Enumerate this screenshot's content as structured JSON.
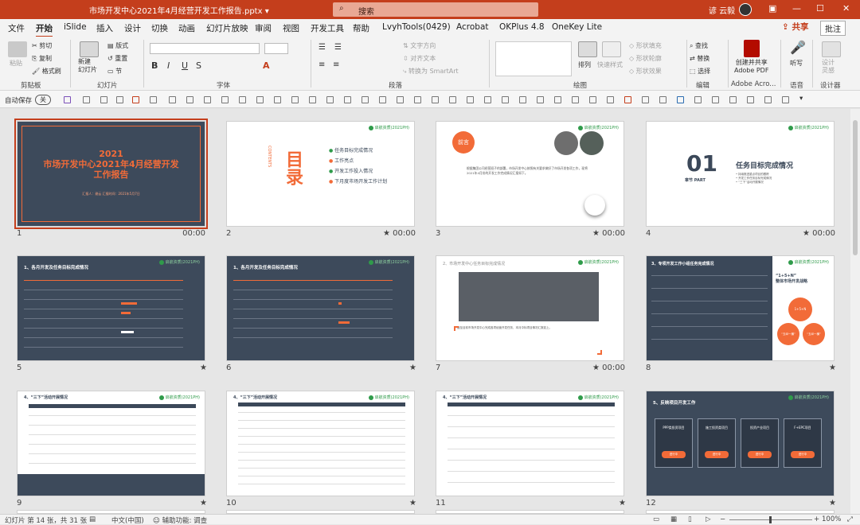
{
  "titlebar": {
    "title": "市场开发中心2021年4月经营开发工作报告.pptx  ▾",
    "search": "搜索",
    "user": "谚 云毅",
    "icons": [
      "minimize-icon",
      "maximize-icon",
      "close-icon"
    ]
  },
  "menu": {
    "items": [
      "文件",
      "开始",
      "iSlide",
      "插入",
      "设计",
      "切换",
      "动画",
      "幻灯片放映",
      "审阅",
      "视图",
      "开发工具",
      "帮助",
      "LvyhTools(0429)",
      "Acrobat",
      "OKPlus 4.8",
      "OneKey Lite"
    ],
    "active": "开始",
    "share": "共享",
    "comment": "批注"
  },
  "ribbon": {
    "clipboard": {
      "paste": "粘贴",
      "cut": "剪切",
      "copy": "复制",
      "format": "格式刷",
      "group": "剪贴板"
    },
    "slides": {
      "new": "新建\n幻灯片",
      "layout": "版式",
      "reset": "重置",
      "section": "节",
      "group": "幻灯片"
    },
    "font": {
      "group": "字体",
      "font_name": "",
      "font_size": ""
    },
    "paragraph": {
      "group": "段落",
      "direction": "文字方向",
      "align": "对齐文本",
      "smartart": "转换为 SmartArt"
    },
    "drawing": {
      "group": "绘图",
      "arrange": "排列",
      "quick": "快速样式",
      "fill": "形状填充",
      "outline": "形状轮廓",
      "effect": "形状效果"
    },
    "editing": {
      "group": "编辑",
      "find": "查找",
      "replace": "替换",
      "select": "选择"
    },
    "adobe": {
      "group": "Adobe Acro...",
      "create": "创建并共享\nAdobe PDF"
    },
    "voice": {
      "group": "语音",
      "dictate": "听写"
    },
    "designer": {
      "group": "设计器",
      "ideas": "设计\n灵感"
    }
  },
  "qat": {
    "autosave": "自动保存",
    "toggle": "关"
  },
  "slides": [
    {
      "n": "1",
      "time": "00:00",
      "title": "2021\n市场开发中心2021年4月经营开发\n工作报告",
      "sub": "汇报人：谢云   汇报时间：2021年5月7日"
    },
    {
      "n": "2",
      "time": "00:00",
      "star": "★",
      "big": "目录",
      "contents": "CONTENTS",
      "items": [
        "任务目标完成情况",
        "工作亮点",
        "开发工作投入情况",
        "下月度市场开发工作计划"
      ]
    },
    {
      "n": "3",
      "time": "00:00",
      "star": "★",
      "tag": "前言",
      "body": "根据集团公司经营班子的部署，市场开发中心按照有关要求做好了市场开发各项工作，现将2021年4月份的开发工作完成情况汇报如下。"
    },
    {
      "n": "4",
      "time": "00:00",
      "star": "★",
      "big": "01",
      "chapter": "章节 PART",
      "heading": "任务目标完成情况",
      "points": [
        "• 持续推进重点项目的跟踪",
        "• 开发工作任务目标完成情况",
        "• “三下”活动开展情况"
      ]
    },
    {
      "n": "5",
      "star": "★",
      "heading": "1、各月开发及任务目标完成情况"
    },
    {
      "n": "6",
      "star": "★",
      "heading": "1、各月开发及任务目标完成情况"
    },
    {
      "n": "7",
      "time": "00:00",
      "star": "★",
      "heading": "2、市场开发中心任务目标完成情况",
      "body": "截至目前市场开发中心完成各项经营开发任务，本月中标项目情况汇报如上。"
    },
    {
      "n": "8",
      "star": "★",
      "heading": "3、专项开发工作小组任务完成情况",
      "quote": "“1+5+N”\n整体市场开发战略",
      "circles": [
        "1+5+N",
        "“五纵一横”",
        "“五纵一横”"
      ]
    },
    {
      "n": "9",
      "star": "★",
      "heading": "4、“三下”活动开展情况"
    },
    {
      "n": "10",
      "star": "★",
      "heading": "4、“三下”活动开展情况"
    },
    {
      "n": "11",
      "star": "★",
      "heading": "4、“三下”活动开展情况"
    },
    {
      "n": "12",
      "star": "★",
      "heading": "5、反映项目开发工作",
      "cards": [
        "PPP类投资项目",
        "施工投资类项目",
        "投资产业项目",
        "F+EPC项目"
      ],
      "btn": "进行中"
    }
  ],
  "logo": "启航资质(2021PH)",
  "status": {
    "slide": "幻灯片 第 14 张，共 31 张",
    "lang": "中文(中国)",
    "access": "辅助功能: 调查",
    "zoom": "100%"
  },
  "colors": {
    "accent": "#c43e1c",
    "orange": "#f26b38",
    "navy": "#3b4859"
  }
}
